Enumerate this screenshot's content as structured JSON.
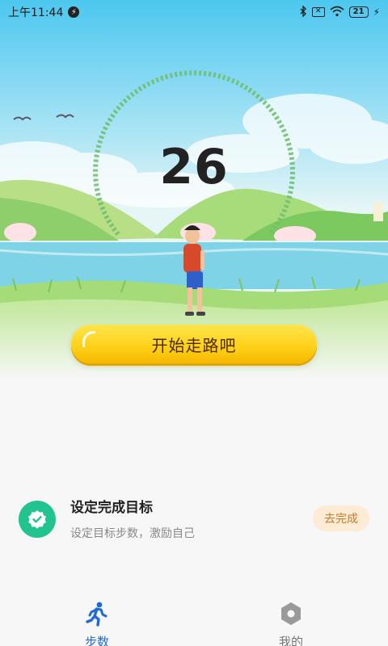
{
  "status_bar": {
    "time": "上午11:44",
    "battery": "21"
  },
  "main": {
    "step_count": "26",
    "start_button_label": "开始走路吧"
  },
  "task": {
    "title": "设定完成目标",
    "description": "设定目标步数，激励自己",
    "action_label": "去完成"
  },
  "bottom_nav": {
    "items": [
      {
        "label": "步数",
        "icon": "walking-person-icon",
        "active": true
      },
      {
        "label": "我的",
        "icon": "hexagon-profile-icon",
        "active": false
      }
    ]
  },
  "colors": {
    "accent_blue": "#1e6bd6",
    "button_yellow": "#ffd21a",
    "task_green": "#21c38e",
    "task_button_bg": "#fdebd6",
    "task_button_text": "#c57b2b",
    "progress_ring": "#6fbf6f"
  }
}
